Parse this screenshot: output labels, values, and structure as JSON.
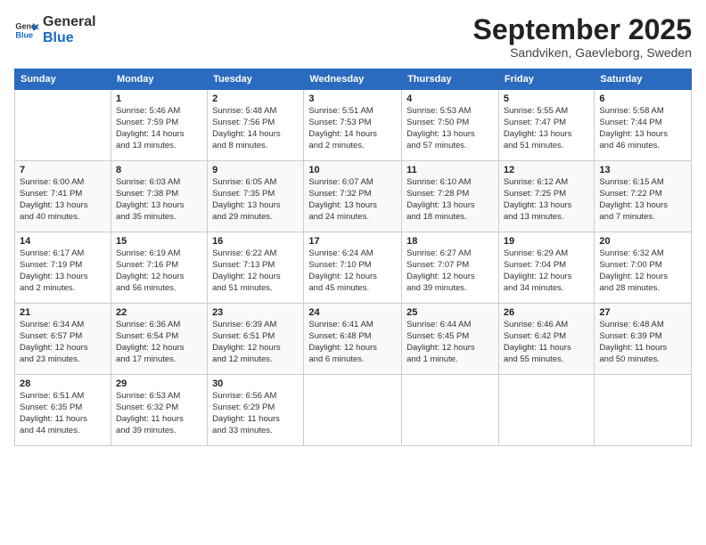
{
  "logo": {
    "line1": "General",
    "line2": "Blue"
  },
  "title": "September 2025",
  "subtitle": "Sandviken, Gaevleborg, Sweden",
  "days_header": [
    "Sunday",
    "Monday",
    "Tuesday",
    "Wednesday",
    "Thursday",
    "Friday",
    "Saturday"
  ],
  "weeks": [
    [
      {
        "day": "",
        "details": ""
      },
      {
        "day": "1",
        "details": "Sunrise: 5:46 AM\nSunset: 7:59 PM\nDaylight: 14 hours\nand 13 minutes."
      },
      {
        "day": "2",
        "details": "Sunrise: 5:48 AM\nSunset: 7:56 PM\nDaylight: 14 hours\nand 8 minutes."
      },
      {
        "day": "3",
        "details": "Sunrise: 5:51 AM\nSunset: 7:53 PM\nDaylight: 14 hours\nand 2 minutes."
      },
      {
        "day": "4",
        "details": "Sunrise: 5:53 AM\nSunset: 7:50 PM\nDaylight: 13 hours\nand 57 minutes."
      },
      {
        "day": "5",
        "details": "Sunrise: 5:55 AM\nSunset: 7:47 PM\nDaylight: 13 hours\nand 51 minutes."
      },
      {
        "day": "6",
        "details": "Sunrise: 5:58 AM\nSunset: 7:44 PM\nDaylight: 13 hours\nand 46 minutes."
      }
    ],
    [
      {
        "day": "7",
        "details": "Sunrise: 6:00 AM\nSunset: 7:41 PM\nDaylight: 13 hours\nand 40 minutes."
      },
      {
        "day": "8",
        "details": "Sunrise: 6:03 AM\nSunset: 7:38 PM\nDaylight: 13 hours\nand 35 minutes."
      },
      {
        "day": "9",
        "details": "Sunrise: 6:05 AM\nSunset: 7:35 PM\nDaylight: 13 hours\nand 29 minutes."
      },
      {
        "day": "10",
        "details": "Sunrise: 6:07 AM\nSunset: 7:32 PM\nDaylight: 13 hours\nand 24 minutes."
      },
      {
        "day": "11",
        "details": "Sunrise: 6:10 AM\nSunset: 7:28 PM\nDaylight: 13 hours\nand 18 minutes."
      },
      {
        "day": "12",
        "details": "Sunrise: 6:12 AM\nSunset: 7:25 PM\nDaylight: 13 hours\nand 13 minutes."
      },
      {
        "day": "13",
        "details": "Sunrise: 6:15 AM\nSunset: 7:22 PM\nDaylight: 13 hours\nand 7 minutes."
      }
    ],
    [
      {
        "day": "14",
        "details": "Sunrise: 6:17 AM\nSunset: 7:19 PM\nDaylight: 13 hours\nand 2 minutes."
      },
      {
        "day": "15",
        "details": "Sunrise: 6:19 AM\nSunset: 7:16 PM\nDaylight: 12 hours\nand 56 minutes."
      },
      {
        "day": "16",
        "details": "Sunrise: 6:22 AM\nSunset: 7:13 PM\nDaylight: 12 hours\nand 51 minutes."
      },
      {
        "day": "17",
        "details": "Sunrise: 6:24 AM\nSunset: 7:10 PM\nDaylight: 12 hours\nand 45 minutes."
      },
      {
        "day": "18",
        "details": "Sunrise: 6:27 AM\nSunset: 7:07 PM\nDaylight: 12 hours\nand 39 minutes."
      },
      {
        "day": "19",
        "details": "Sunrise: 6:29 AM\nSunset: 7:04 PM\nDaylight: 12 hours\nand 34 minutes."
      },
      {
        "day": "20",
        "details": "Sunrise: 6:32 AM\nSunset: 7:00 PM\nDaylight: 12 hours\nand 28 minutes."
      }
    ],
    [
      {
        "day": "21",
        "details": "Sunrise: 6:34 AM\nSunset: 6:57 PM\nDaylight: 12 hours\nand 23 minutes."
      },
      {
        "day": "22",
        "details": "Sunrise: 6:36 AM\nSunset: 6:54 PM\nDaylight: 12 hours\nand 17 minutes."
      },
      {
        "day": "23",
        "details": "Sunrise: 6:39 AM\nSunset: 6:51 PM\nDaylight: 12 hours\nand 12 minutes."
      },
      {
        "day": "24",
        "details": "Sunrise: 6:41 AM\nSunset: 6:48 PM\nDaylight: 12 hours\nand 6 minutes."
      },
      {
        "day": "25",
        "details": "Sunrise: 6:44 AM\nSunset: 6:45 PM\nDaylight: 12 hours\nand 1 minute."
      },
      {
        "day": "26",
        "details": "Sunrise: 6:46 AM\nSunset: 6:42 PM\nDaylight: 11 hours\nand 55 minutes."
      },
      {
        "day": "27",
        "details": "Sunrise: 6:48 AM\nSunset: 6:39 PM\nDaylight: 11 hours\nand 50 minutes."
      }
    ],
    [
      {
        "day": "28",
        "details": "Sunrise: 6:51 AM\nSunset: 6:35 PM\nDaylight: 11 hours\nand 44 minutes."
      },
      {
        "day": "29",
        "details": "Sunrise: 6:53 AM\nSunset: 6:32 PM\nDaylight: 11 hours\nand 39 minutes."
      },
      {
        "day": "30",
        "details": "Sunrise: 6:56 AM\nSunset: 6:29 PM\nDaylight: 11 hours\nand 33 minutes."
      },
      {
        "day": "",
        "details": ""
      },
      {
        "day": "",
        "details": ""
      },
      {
        "day": "",
        "details": ""
      },
      {
        "day": "",
        "details": ""
      }
    ]
  ]
}
